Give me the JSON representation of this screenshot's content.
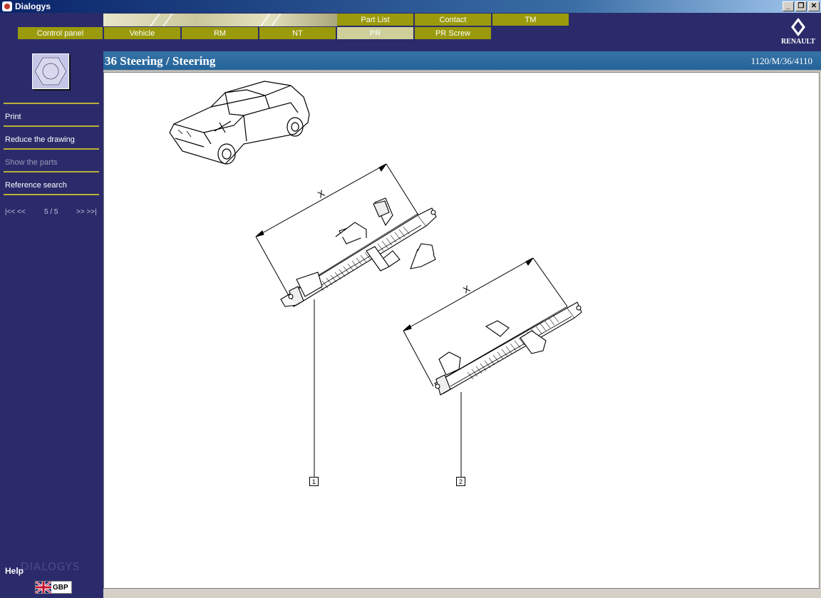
{
  "window": {
    "title": "Dialogys"
  },
  "window_buttons": {
    "minimize": "_",
    "restore": "❐",
    "close": "✕"
  },
  "tabs_top": [
    {
      "label": "Part List"
    },
    {
      "label": "Contact"
    },
    {
      "label": "TM"
    }
  ],
  "tabs_main": [
    {
      "label": "Control panel"
    },
    {
      "label": "Vehicle"
    },
    {
      "label": "RM"
    },
    {
      "label": "NT"
    },
    {
      "label": "PR",
      "active": true
    },
    {
      "label": "PR Screw"
    }
  ],
  "brand_logo": {
    "text": "RENAULT"
  },
  "sidebar": {
    "menu": [
      {
        "label": "Print"
      },
      {
        "label": "Reduce the drawing"
      },
      {
        "label": "Show the parts",
        "disabled": true
      },
      {
        "label": "Reference search"
      }
    ],
    "pager": {
      "first_prev": "|<< <<",
      "position": "5 / 5",
      "next_last": ">> >>|"
    },
    "help": "Help",
    "watermark": "DIALOGYS",
    "language": "GBP"
  },
  "page": {
    "title": "36 Steering / Steering",
    "reference": "1120/M/36/4110"
  },
  "drawing": {
    "dimension_label": "X",
    "callouts": [
      "1",
      "2"
    ]
  },
  "colors": {
    "navy": "#2b2b6b",
    "tab_olive": "#9a9a0c",
    "tab_active": "#cfcf9a",
    "title_strip": "#2e6ba0",
    "separator": "#b8b03a"
  }
}
